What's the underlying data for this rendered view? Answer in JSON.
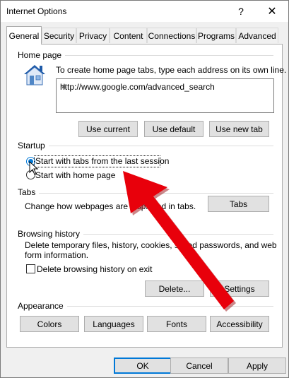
{
  "window": {
    "title": "Internet Options",
    "help_glyph": "?",
    "close_glyph": "✕"
  },
  "tabs": [
    {
      "label": "General",
      "active": true
    },
    {
      "label": "Security"
    },
    {
      "label": "Privacy"
    },
    {
      "label": "Content"
    },
    {
      "label": "Connections"
    },
    {
      "label": "Programs"
    },
    {
      "label": "Advanced"
    }
  ],
  "home_page": {
    "group_label": "Home page",
    "icon": "house-icon",
    "description": "To create home page tabs, type each address on its own line.",
    "url_value": "http://www.google.com/advanced_search",
    "use_current_label": "Use current",
    "use_default_label": "Use default",
    "use_new_tab_label": "Use new tab"
  },
  "startup": {
    "group_label": "Startup",
    "option_last_session": "Start with tabs from the last session",
    "option_home_page": "Start with home page",
    "selected": "last_session"
  },
  "tabs_section": {
    "group_label": "Tabs",
    "description": "Change how webpages are displayed in tabs.",
    "button_label": "Tabs"
  },
  "browsing_history": {
    "group_label": "Browsing history",
    "description_line1": "Delete temporary files, history, cookies, saved passwords, and web",
    "description_line2": "form information.",
    "checkbox_label": "Delete browsing history on exit",
    "checkbox_checked": false,
    "delete_label": "Delete...",
    "settings_label": "Settings"
  },
  "appearance": {
    "group_label": "Appearance",
    "colors_label": "Colors",
    "languages_label": "Languages",
    "fonts_label": "Fonts",
    "accessibility_label": "Accessibility"
  },
  "footer": {
    "ok_label": "OK",
    "cancel_label": "Cancel",
    "apply_label": "Apply"
  },
  "colors": {
    "accent": "#0078d7",
    "annotation_arrow": "#e8000b"
  }
}
